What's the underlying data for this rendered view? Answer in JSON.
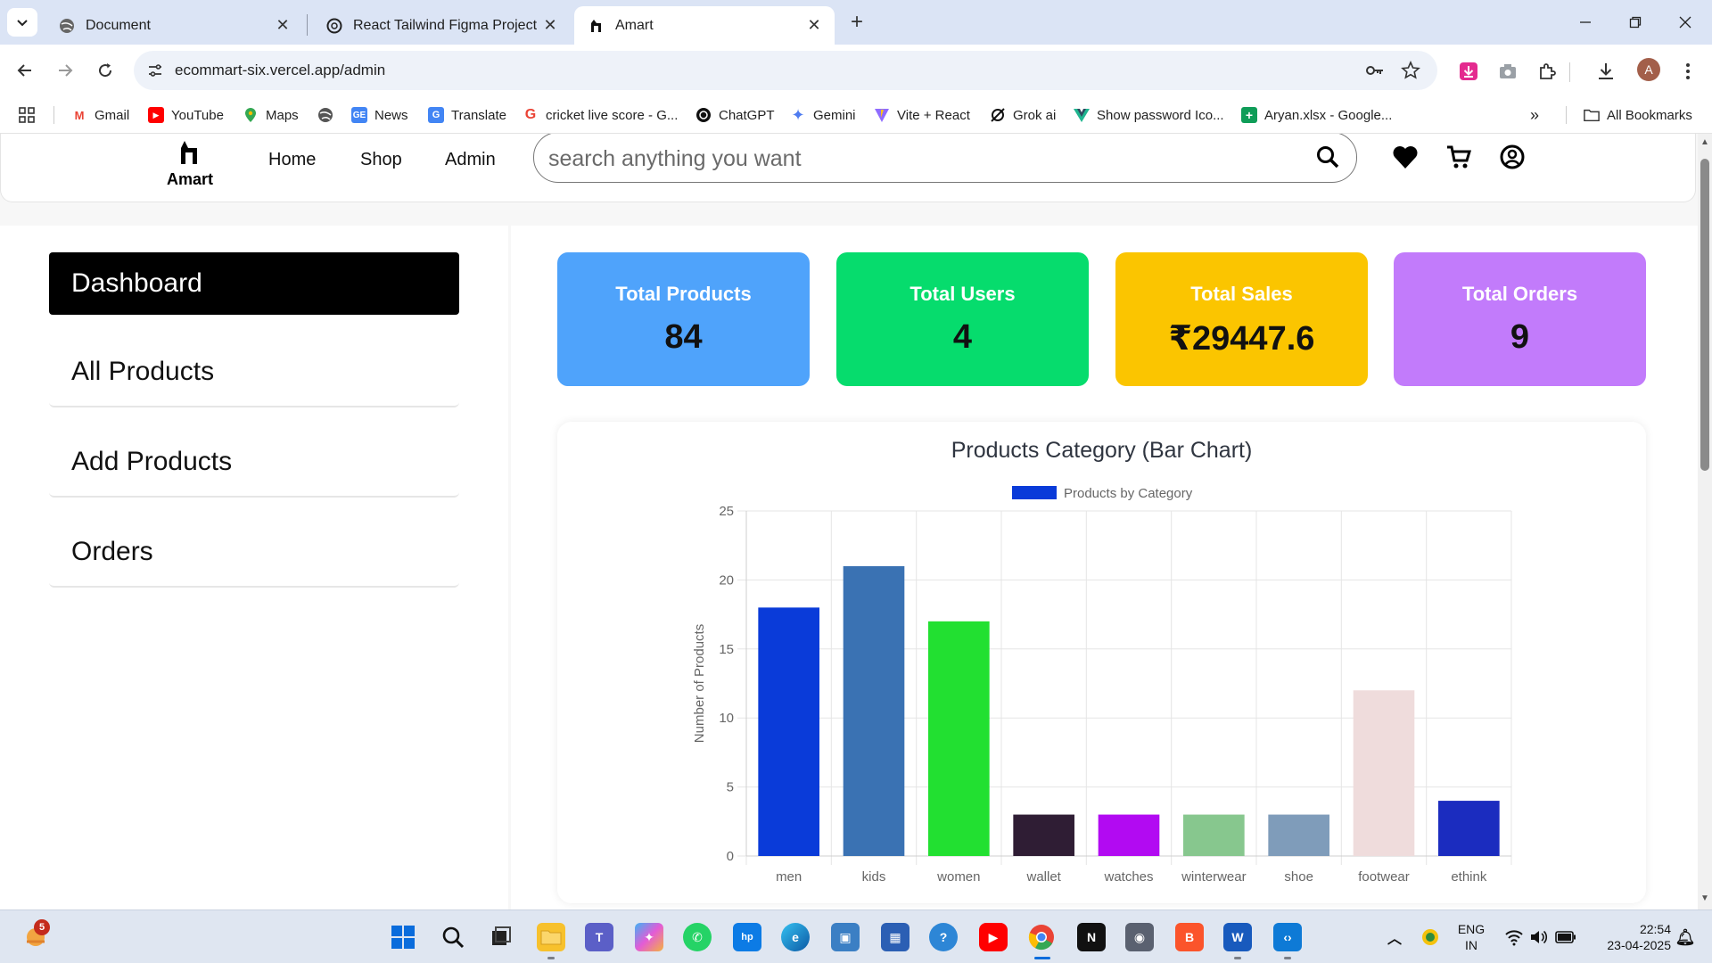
{
  "browser": {
    "tabs": [
      {
        "title": "Document",
        "icon": "globe-icon",
        "active": false
      },
      {
        "title": "React Tailwind Figma Project",
        "icon": "openai-icon",
        "active": false
      },
      {
        "title": "Amart",
        "icon": "amart-icon",
        "active": true
      }
    ],
    "url": "ecommart-six.vercel.app/admin",
    "profile_initial": "A",
    "bookmarks": [
      {
        "label": "Gmail",
        "icon": "gmail-icon",
        "color": "#ea4335"
      },
      {
        "label": "YouTube",
        "icon": "youtube-icon",
        "color": "#ff0000"
      },
      {
        "label": "Maps",
        "icon": "maps-icon",
        "color": "#34a853"
      },
      {
        "label": "",
        "icon": "globe-icon",
        "color": "#555555"
      },
      {
        "label": "News",
        "icon": "news-icon",
        "color": "#4285f4"
      },
      {
        "label": "Translate",
        "icon": "translate-icon",
        "color": "#4285f4"
      },
      {
        "label": "cricket live score - G...",
        "icon": "google-icon",
        "color": "#ea4335"
      },
      {
        "label": "ChatGPT",
        "icon": "openai-icon",
        "color": "#111111"
      },
      {
        "label": "Gemini",
        "icon": "gemini-icon",
        "color": "#4f7cf0"
      },
      {
        "label": "Vite + React",
        "icon": "vite-icon",
        "color": "#a25bff"
      },
      {
        "label": "Grok ai",
        "icon": "grok-icon",
        "color": "#111111"
      },
      {
        "label": "Show password Ico...",
        "icon": "vue-icon",
        "color": "#1fb58f"
      },
      {
        "label": "Aryan.xlsx - Google...",
        "icon": "sheets-icon",
        "color": "#0f9d58"
      }
    ],
    "all_bookmarks_label": "All Bookmarks"
  },
  "site": {
    "logo_text": "Amart",
    "nav": [
      "Home",
      "Shop",
      "Admin"
    ],
    "search_placeholder": "search anything you want"
  },
  "sidebar": {
    "items": [
      "Dashboard",
      "All Products",
      "Add Products",
      "Orders"
    ],
    "active": "Dashboard"
  },
  "stats": [
    {
      "label": "Total Products",
      "value": "84",
      "color": "#4fa3fb"
    },
    {
      "label": "Total Users",
      "value": "4",
      "color": "#06dc6d"
    },
    {
      "label": "Total Sales",
      "value": "₹29447.6",
      "color": "#fbc500"
    },
    {
      "label": "Total Orders",
      "value": "9",
      "color": "#c27bfb"
    }
  ],
  "chart_data": {
    "type": "bar",
    "title": "Products Category (Bar Chart)",
    "legend": "Products by Category",
    "legend_position": "top",
    "ylabel": "Number of Products",
    "xlabel": "",
    "ylim": [
      0,
      25
    ],
    "yticks": [
      0,
      5,
      10,
      15,
      20,
      25
    ],
    "grid": true,
    "categories": [
      "men",
      "kids",
      "women",
      "wallet",
      "watches",
      "winterwear",
      "shoe",
      "footwear",
      "ethink"
    ],
    "values": [
      18,
      21,
      17,
      3,
      3,
      3,
      3,
      12,
      4
    ],
    "colors": [
      "#0a3bd9",
      "#3a72b3",
      "#22e031",
      "#2f1d34",
      "#b20af2",
      "#87c78e",
      "#7f9cba",
      "#efdcdc",
      "#1b2cbf"
    ],
    "legend_color": "#0a3bd9"
  },
  "taskbar": {
    "notification_count": "5",
    "language": "ENG",
    "region": "IN",
    "time": "22:54",
    "date": "23-04-2025",
    "apps": [
      "windows-start-icon",
      "search-icon",
      "task-view-icon",
      "file-explorer-icon",
      "teams-icon",
      "copilot-icon",
      "whatsapp-icon",
      "myhp-icon",
      "edge-icon",
      "control-panel-icon",
      "store-icon",
      "help-icon",
      "youtube-icon",
      "chrome-icon",
      "notion-icon",
      "camera-icon",
      "brave-icon",
      "word-icon",
      "vscode-icon"
    ]
  }
}
